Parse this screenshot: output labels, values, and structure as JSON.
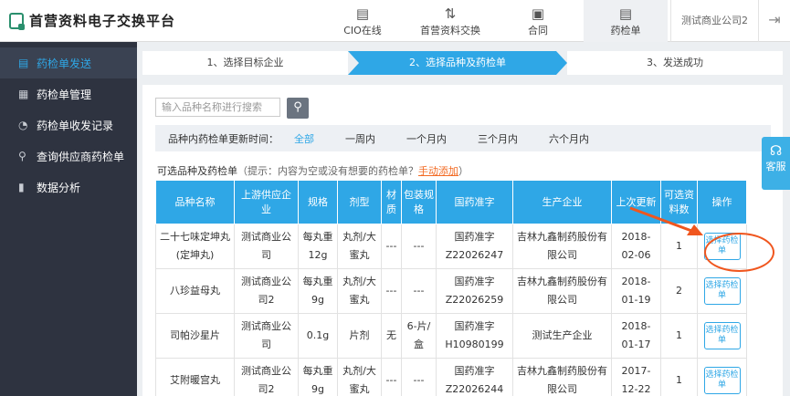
{
  "app": {
    "title": "首营资料电子交换平台"
  },
  "nav": [
    {
      "label": "CIO在线",
      "icon": "document-icon",
      "glyph": "▤"
    },
    {
      "label": "首营资料交换",
      "icon": "swap-icon",
      "glyph": "⇅"
    },
    {
      "label": "合同",
      "icon": "contract-icon",
      "glyph": "▣"
    },
    {
      "label": "药检单",
      "icon": "report-icon",
      "glyph": "▤"
    }
  ],
  "company": "测试商业公司2",
  "sidebar": [
    {
      "label": "药检单发送",
      "glyph": "▤"
    },
    {
      "label": "药检单管理",
      "glyph": "▦"
    },
    {
      "label": "药检单收发记录",
      "glyph": "◔"
    },
    {
      "label": "查询供应商药检单",
      "glyph": "⚲"
    },
    {
      "label": "数据分析",
      "glyph": "▮"
    }
  ],
  "steps": [
    "1、选择目标企业",
    "2、选择品种及药检单",
    "3、发送成功"
  ],
  "search": {
    "placeholder": "输入品种名称进行搜索"
  },
  "filter": {
    "label": "品种内药检单更新时间：",
    "options": [
      "全部",
      "一周内",
      "一个月内",
      "三个月内",
      "六个月内"
    ]
  },
  "hint": {
    "title": "可选品种及药检单",
    "text": "（提示：内容为空或没有想要的药检单？",
    "link": "手动添加",
    "end": "）"
  },
  "table": {
    "headers": [
      "品种名称",
      "上游供应企业",
      "规格",
      "剂型",
      "材质",
      "包装规格",
      "国药准字",
      "生产企业",
      "上次更新",
      "可选资料数",
      "操作"
    ],
    "rows": [
      [
        "二十七味定坤丸(定坤丸)",
        "测试商业公司",
        "每丸重12g",
        "丸剂/大蜜丸",
        "---",
        "---",
        "国药准字Z22026247",
        "吉林九鑫制药股份有限公司",
        "2018-02-06",
        "1",
        "选择药检单"
      ],
      [
        "八珍益母丸",
        "测试商业公司2",
        "每丸重9g",
        "丸剂/大蜜丸",
        "---",
        "---",
        "国药准字Z22026259",
        "吉林九鑫制药股份有限公司",
        "2018-01-19",
        "2",
        "选择药检单"
      ],
      [
        "司帕沙星片",
        "测试商业公司",
        "0.1g",
        "片剂",
        "无",
        "6-片/盒",
        "国药准字H10980199",
        "测试生产企业",
        "2018-01-17",
        "1",
        "选择药检单"
      ],
      [
        "艾附暖宫丸",
        "测试商业公司2",
        "每丸重9g",
        "丸剂/大蜜丸",
        "---",
        "---",
        "国药准字Z22026244",
        "吉林九鑫制药股份有限公司",
        "2017-12-22",
        "1",
        "选择药检单"
      ]
    ]
  },
  "service": {
    "label": "客服"
  },
  "colors": {
    "accent": "#2fa7e6",
    "sidebar": "#2e3340",
    "annotation": "#f0561e"
  }
}
